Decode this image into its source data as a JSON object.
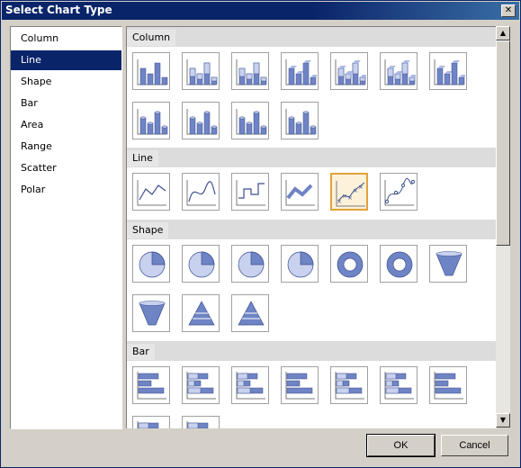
{
  "window": {
    "title": "Select Chart Type",
    "close_glyph": "✕"
  },
  "categories": [
    {
      "label": "Column",
      "selected": false
    },
    {
      "label": "Line",
      "selected": true
    },
    {
      "label": "Shape",
      "selected": false
    },
    {
      "label": "Bar",
      "selected": false
    },
    {
      "label": "Area",
      "selected": false
    },
    {
      "label": "Range",
      "selected": false
    },
    {
      "label": "Scatter",
      "selected": false
    },
    {
      "label": "Polar",
      "selected": false
    }
  ],
  "groups": [
    {
      "label": "Column",
      "thumbnails": [
        "column-clustered-icon",
        "column-stacked-icon",
        "column-100-stacked-icon",
        "column-3d-clustered-icon",
        "column-3d-stacked-icon",
        "column-3d-100-stacked-icon",
        "column-3d-icon",
        "cylinder-clustered-icon",
        "cylinder-stacked-icon",
        "cylinder-100-stacked-icon",
        "cylinder-3d-icon"
      ]
    },
    {
      "label": "Line",
      "thumbnails": [
        "line-icon",
        "smooth-line-icon",
        "stepped-line-icon",
        "line-3d-icon",
        "line-markers-icon",
        "smooth-line-markers-icon"
      ],
      "selected_index": 4
    },
    {
      "label": "Shape",
      "thumbnails": [
        "pie-icon",
        "exploded-pie-icon",
        "pie-3d-icon",
        "exploded-pie-3d-icon",
        "doughnut-icon",
        "exploded-doughnut-icon",
        "funnel-icon",
        "funnel-3d-icon",
        "pyramid-icon",
        "pyramid-3d-icon"
      ]
    },
    {
      "label": "Bar",
      "thumbnails": [
        "bar-clustered-icon",
        "bar-stacked-icon",
        "bar-100-stacked-icon",
        "bar-3d-clustered-icon",
        "bar-3d-stacked-icon",
        "bar-3d-100-stacked-icon",
        "bar-cylinder-icon",
        "bar-cylinder-stacked-icon",
        "bar-cylinder-100-stacked-icon"
      ]
    }
  ],
  "buttons": {
    "ok": "OK",
    "cancel": "Cancel"
  },
  "colors": {
    "selection": "#0a246a",
    "accent": "#e3a23a",
    "chart_blue": "#6f84c4"
  }
}
